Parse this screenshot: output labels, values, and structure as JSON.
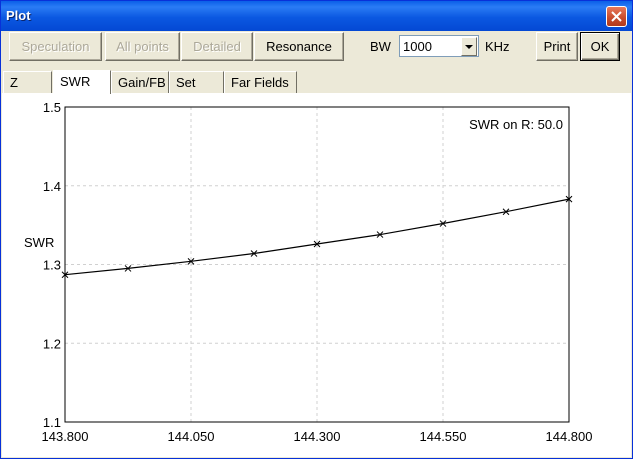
{
  "window": {
    "title": "Plot"
  },
  "toolbar": {
    "speculation": "Speculation",
    "all_points": "All points",
    "detailed": "Detailed",
    "resonance": "Resonance",
    "bw_label": "BW",
    "bw_value": "1000",
    "unit": "KHz",
    "print": "Print",
    "ok": "OK"
  },
  "tabs": [
    "Z",
    "SWR",
    "Gain/FB",
    "Set",
    "Far Fields"
  ],
  "active_tab": "SWR",
  "icons": {
    "close": "close-icon",
    "dropdown": "chevron-down-icon"
  },
  "colors": {
    "title_bar": "#0b58e1",
    "close_button": "#c64a2b",
    "curve": "#000000",
    "grid": "#d0d0d0"
  },
  "chart_data": {
    "type": "line",
    "annotation": "SWR on R: 50.0",
    "ylabel": "SWR",
    "xlabel": "",
    "x_ticks": [
      "143.800",
      "144.050",
      "144.300",
      "144.550",
      "144.800"
    ],
    "y_ticks": [
      "1.5",
      "1.4",
      "1.3",
      "1.2",
      "1.1"
    ],
    "xlim": [
      143.8,
      144.8
    ],
    "ylim": [
      1.1,
      1.5
    ],
    "grid": true,
    "series": [
      {
        "x": [
          143.8,
          143.925,
          144.05,
          144.175,
          144.3,
          144.425,
          144.55,
          144.675,
          144.8
        ],
        "y": [
          1.287,
          1.295,
          1.304,
          1.314,
          1.326,
          1.338,
          1.352,
          1.367,
          1.383
        ]
      }
    ]
  }
}
